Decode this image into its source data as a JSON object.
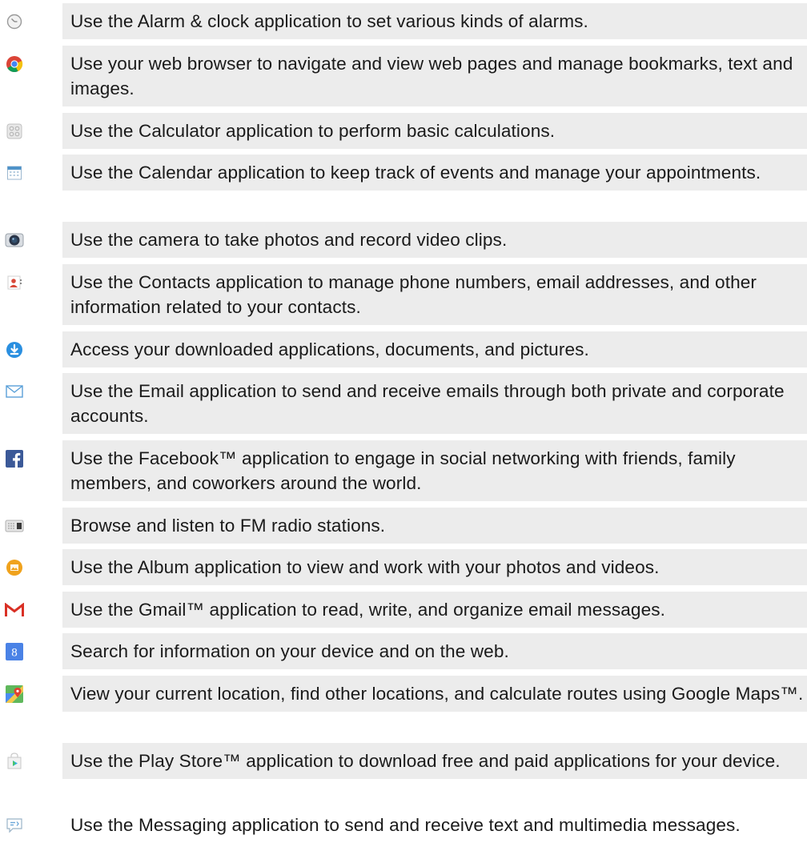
{
  "rows": [
    {
      "icon": "alarm-clock-icon",
      "text": "Use the Alarm & clock application to set various kinds of alarms."
    },
    {
      "icon": "chrome-browser-icon",
      "text": "Use your web browser to navigate and view web pages and manage bookmarks, text and images."
    },
    {
      "icon": "calculator-icon",
      "text": "Use the Calculator application to perform basic calculations."
    },
    {
      "icon": "calendar-icon",
      "text": "Use the Calendar application to keep track of events and manage your appointments."
    },
    {
      "icon": "camera-icon",
      "text": "Use the camera to take photos and record video clips."
    },
    {
      "icon": "contacts-icon",
      "text": "Use the Contacts application to manage phone numbers, email addresses, and other information related to your contacts."
    },
    {
      "icon": "downloads-icon",
      "text": "Access your downloaded applications, documents, and pictures."
    },
    {
      "icon": "email-icon",
      "text": "Use the Email application to send and receive emails through both private and corporate accounts."
    },
    {
      "icon": "facebook-icon",
      "text": "Use the Facebook™ application to engage in social networking with friends, family members, and coworkers around the world."
    },
    {
      "icon": "fm-radio-icon",
      "text": "Browse and listen to FM radio stations."
    },
    {
      "icon": "album-icon",
      "text": "Use the Album application to view and work with your photos and videos."
    },
    {
      "icon": "gmail-icon",
      "text": "Use the Gmail™ application to read, write, and organize email messages."
    },
    {
      "icon": "google-search-icon",
      "text": "Search for information on your device and on the web."
    },
    {
      "icon": "google-maps-icon",
      "text": "View your current location, find other locations, and calculate routes using Google Maps™."
    },
    {
      "icon": "play-store-icon",
      "text": "Use the Play Store™ application to download free and paid applications for your device."
    },
    {
      "icon": "messaging-icon",
      "text": "Use the Messaging application to send and receive text and multimedia messages."
    }
  ],
  "colors": {
    "row_background": "#ececec",
    "text": "#1a1a1a"
  }
}
